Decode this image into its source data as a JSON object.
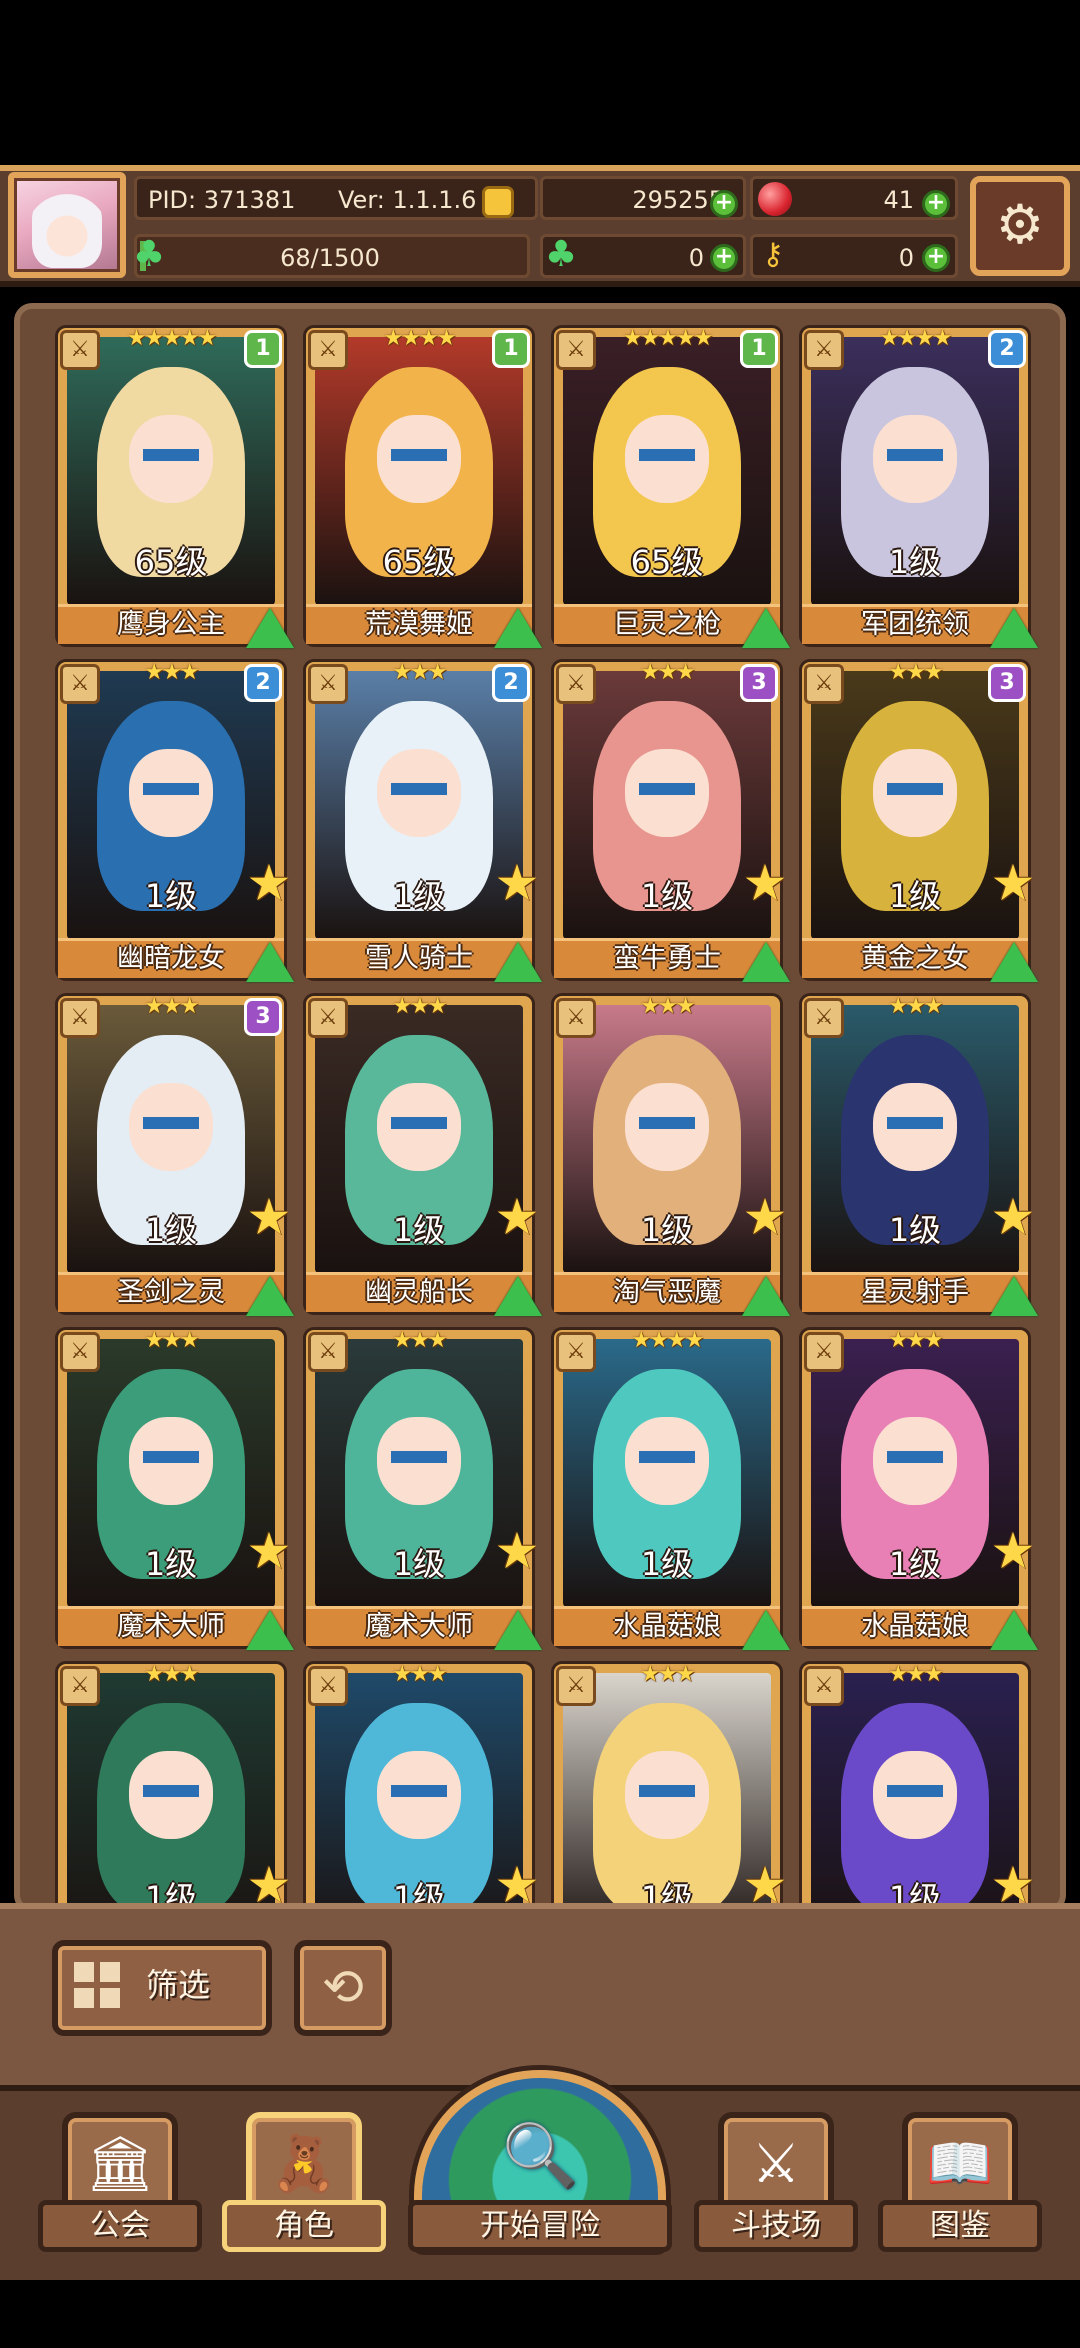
{
  "header": {
    "pid_label": "PID: 371381",
    "version_label": "Ver: 1.1.1.6",
    "exp": "68/1500",
    "gold": "295255",
    "gems": "41",
    "clovers": "0",
    "keys": "0",
    "plus_symbol": "+",
    "gear_symbol": "⚙",
    "clover_symbol": "♣",
    "key_symbol": "⚷"
  },
  "cards": [
    {
      "name": "鹰身公主",
      "level": "65级",
      "stars": "★★★★★",
      "rank": "1",
      "rank_color": "#5fb64a",
      "hair": "#f1d9a2",
      "bg": "#2f6b5a",
      "weapon": "⚔",
      "upgrade": true,
      "big_star": false
    },
    {
      "name": "荒漠舞姬",
      "level": "65级",
      "stars": "★★★★",
      "rank": "1",
      "rank_color": "#5fb64a",
      "hair": "#f2b44a",
      "bg": "#b33a2a",
      "weapon": "⚔",
      "upgrade": true,
      "big_star": false
    },
    {
      "name": "巨灵之枪",
      "level": "65级",
      "stars": "★★★★★",
      "rank": "1",
      "rank_color": "#5fb64a",
      "hair": "#f3c64e",
      "bg": "#3a1f26",
      "weapon": "⚔",
      "upgrade": true,
      "big_star": false
    },
    {
      "name": "军团统领",
      "level": "1级",
      "stars": "★★★★",
      "rank": "2",
      "rank_color": "#3c8fd6",
      "hair": "#c9c5de",
      "bg": "#3b2f5c",
      "weapon": "⚔",
      "upgrade": true,
      "big_star": false
    },
    {
      "name": "幽暗龙女",
      "level": "1级",
      "stars": "★★★",
      "rank": "2",
      "rank_color": "#3c8fd6",
      "hair": "#2a6fb0",
      "bg": "#1f3a52",
      "weapon": "⚔",
      "upgrade": true,
      "big_star": true
    },
    {
      "name": "雪人骑士",
      "level": "1级",
      "stars": "★★★",
      "rank": "2",
      "rank_color": "#3c8fd6",
      "hair": "#e8f1f8",
      "bg": "#5a7fa8",
      "weapon": "⚔",
      "upgrade": true,
      "big_star": true
    },
    {
      "name": "蛮牛勇士",
      "level": "1级",
      "stars": "★★★",
      "rank": "3",
      "rank_color": "#9d4fc4",
      "hair": "#e8958f",
      "bg": "#6b3a3a",
      "weapon": "⚔",
      "upgrade": true,
      "big_star": true
    },
    {
      "name": "黄金之女",
      "level": "1级",
      "stars": "★★★",
      "rank": "3",
      "rank_color": "#9d4fc4",
      "hair": "#d7b23c",
      "bg": "#4a3a1a",
      "weapon": "⚔",
      "upgrade": true,
      "big_star": true
    },
    {
      "name": "圣剑之灵",
      "level": "1级",
      "stars": "★★★",
      "rank": "3",
      "rank_color": "#9d4fc4",
      "hair": "#e4ecf4",
      "bg": "#6a5a3a",
      "weapon": "⚔",
      "upgrade": true,
      "big_star": true
    },
    {
      "name": "幽灵船长",
      "level": "1级",
      "stars": "★★★",
      "rank": "",
      "rank_color": "",
      "hair": "#59b79a",
      "bg": "#3a2a24",
      "weapon": "⚔",
      "upgrade": true,
      "big_star": true
    },
    {
      "name": "淘气恶魔",
      "level": "1级",
      "stars": "★★★",
      "rank": "",
      "rank_color": "",
      "hair": "#e2b07a",
      "bg": "#c87a8a",
      "weapon": "⚔",
      "upgrade": true,
      "big_star": true
    },
    {
      "name": "星灵射手",
      "level": "1级",
      "stars": "★★★",
      "rank": "",
      "rank_color": "",
      "hair": "#2a3570",
      "bg": "#2a5a6a",
      "weapon": "⚔",
      "upgrade": true,
      "big_star": true
    },
    {
      "name": "魔术大师",
      "level": "1级",
      "stars": "★★★",
      "rank": "",
      "rank_color": "",
      "hair": "#3b9d7a",
      "bg": "#2a3a2a",
      "weapon": "⚔",
      "upgrade": true,
      "big_star": true
    },
    {
      "name": "魔术大师",
      "level": "1级",
      "stars": "★★★",
      "rank": "",
      "rank_color": "",
      "hair": "#4fb59a",
      "bg": "#2a3a3a",
      "weapon": "⚔",
      "upgrade": true,
      "big_star": true
    },
    {
      "name": "水晶菇娘",
      "level": "1级",
      "stars": "★★★★",
      "rank": "",
      "rank_color": "",
      "hair": "#4fc8c0",
      "bg": "#2a6a8a",
      "weapon": "⚔",
      "upgrade": true,
      "big_star": false
    },
    {
      "name": "水晶菇娘",
      "level": "1级",
      "stars": "★★★",
      "rank": "",
      "rank_color": "",
      "hair": "#e87fb5",
      "bg": "#3a2050",
      "weapon": "⚔",
      "upgrade": true,
      "big_star": true
    },
    {
      "name": "",
      "level": "1级",
      "stars": "★★★",
      "rank": "",
      "rank_color": "",
      "hair": "#2f7a5a",
      "bg": "#1f3a32",
      "weapon": "⚔",
      "upgrade": false,
      "big_star": true
    },
    {
      "name": "",
      "level": "1级",
      "stars": "★★★",
      "rank": "",
      "rank_color": "",
      "hair": "#4fb8d8",
      "bg": "#1f4a6a",
      "weapon": "⚔",
      "upgrade": false,
      "big_star": true
    },
    {
      "name": "",
      "level": "1级",
      "stars": "★★★",
      "rank": "",
      "rank_color": "",
      "hair": "#f3d27a",
      "bg": "#d9d4cc",
      "weapon": "⚔",
      "upgrade": false,
      "big_star": true
    },
    {
      "name": "",
      "level": "1级",
      "stars": "★★★",
      "rank": "",
      "rank_color": "",
      "hair": "#6a4ac8",
      "bg": "#2a2050",
      "weapon": "⚔",
      "upgrade": false,
      "big_star": true
    }
  ],
  "filter": {
    "label": "筛选",
    "refresh_symbol": "⟲"
  },
  "nav": [
    {
      "label": "公会",
      "icon": "🏛",
      "active": false
    },
    {
      "label": "角色",
      "icon": "🧸",
      "active": true
    },
    {
      "label": "开始冒险",
      "icon": "🔍",
      "active": false
    },
    {
      "label": "斗技场",
      "icon": "⚔",
      "active": false
    },
    {
      "label": "图鉴",
      "icon": "📖",
      "active": false
    }
  ]
}
